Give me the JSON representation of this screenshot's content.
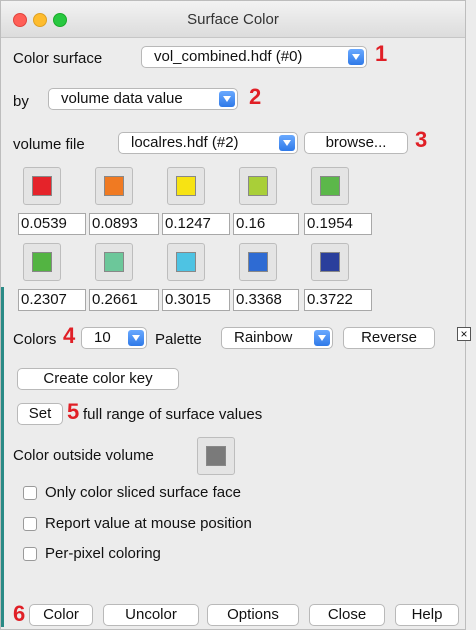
{
  "window": {
    "title": "Surface Color"
  },
  "row_surface": {
    "label": "Color surface",
    "value": "vol_combined.hdf (#0)",
    "marker": "1"
  },
  "row_by": {
    "label": "by",
    "value": "volume data value",
    "marker": "2"
  },
  "row_volume": {
    "label": "volume file",
    "value": "localres.hdf (#2)",
    "browse_label": "browse...",
    "marker": "3"
  },
  "palette": {
    "swatches": [
      {
        "color": "#e5232a",
        "value": "0.0539"
      },
      {
        "color": "#f07a22",
        "value": "0.0893"
      },
      {
        "color": "#f7e313",
        "value": "0.1247"
      },
      {
        "color": "#a9cf38",
        "value": "0.16"
      },
      {
        "color": "#5cb84a",
        "value": "0.1954"
      },
      {
        "color": "#53b442",
        "value": "0.2307"
      },
      {
        "color": "#6cc79a",
        "value": "0.2661"
      },
      {
        "color": "#4ec3e3",
        "value": "0.3015"
      },
      {
        "color": "#2e6bd3",
        "value": "0.3368"
      },
      {
        "color": "#2a3f9c",
        "value": "0.3722"
      }
    ]
  },
  "colors_row": {
    "label": "Colors",
    "marker": "4",
    "count": "10",
    "palette_label": "Palette",
    "palette_value": "Rainbow",
    "reverse_label": "Reverse",
    "close_x": "×"
  },
  "create_key": {
    "label": "Create color key"
  },
  "set_row": {
    "button": "Set",
    "marker": "5",
    "text": "full range of surface values"
  },
  "outside": {
    "label": "Color outside volume",
    "color": "#7a7a7a"
  },
  "checks": {
    "sliced": "Only color sliced surface face",
    "report": "Report value at mouse position",
    "perpixel": "Per-pixel coloring"
  },
  "footer": {
    "marker": "6",
    "color": "Color",
    "uncolor": "Uncolor",
    "options": "Options",
    "close": "Close",
    "help": "Help"
  }
}
